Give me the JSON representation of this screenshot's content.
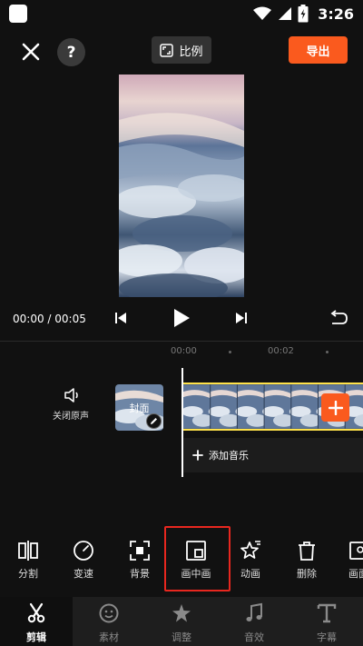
{
  "status_bar": {
    "time": "3:26"
  },
  "top_bar": {
    "help_label": "?",
    "ratio_label": "比例",
    "export_label": "导出"
  },
  "playback": {
    "time_display": "00:00 / 00:05"
  },
  "ruler": {
    "marks": [
      "00:00",
      "00:02"
    ]
  },
  "timeline": {
    "mute_label": "关闭原声",
    "cover_label": "封面",
    "add_music_label": "添加音乐"
  },
  "tools": [
    {
      "label": "分割",
      "icon": "split-icon"
    },
    {
      "label": "变速",
      "icon": "speed-icon"
    },
    {
      "label": "背景",
      "icon": "background-icon"
    },
    {
      "label": "画中画",
      "icon": "picture-in-picture-icon",
      "selected": true
    },
    {
      "label": "动画",
      "icon": "animation-icon"
    },
    {
      "label": "删除",
      "icon": "delete-icon"
    },
    {
      "label": "画面",
      "icon": "frame-icon"
    }
  ],
  "bottom_nav": [
    {
      "label": "剪辑",
      "icon": "scissors-icon",
      "active": true
    },
    {
      "label": "素材",
      "icon": "sticker-icon"
    },
    {
      "label": "调整",
      "icon": "adjust-icon"
    },
    {
      "label": "音效",
      "icon": "music-note-icon"
    },
    {
      "label": "字幕",
      "icon": "text-icon"
    }
  ],
  "colors": {
    "accent": "#fa5a1e",
    "clip_border": "#ffe24a",
    "selection_highlight": "#e8271f",
    "background": "#111111"
  }
}
